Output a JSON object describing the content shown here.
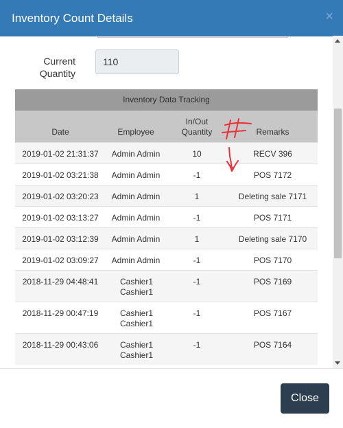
{
  "modal": {
    "title": "Inventory Count Details",
    "close_icon": "close-icon"
  },
  "form": {
    "current_quantity_label": "Current Quantity",
    "current_quantity_value": "110"
  },
  "tracking": {
    "title": "Inventory Data Tracking",
    "columns": [
      "Date",
      "Employee",
      "In/Out Quantity",
      "Remarks"
    ],
    "rows": [
      {
        "date": "2019-01-02 21:31:37",
        "employee": "Admin Admin",
        "quantity": "10",
        "remarks": "RECV 396"
      },
      {
        "date": "2019-01-02 03:21:38",
        "employee": "Admin Admin",
        "quantity": "-1",
        "remarks": "POS 7172"
      },
      {
        "date": "2019-01-02 03:20:23",
        "employee": "Admin Admin",
        "quantity": "1",
        "remarks": "Deleting sale 7171"
      },
      {
        "date": "2019-01-02 03:13:27",
        "employee": "Admin Admin",
        "quantity": "-1",
        "remarks": "POS 7171"
      },
      {
        "date": "2019-01-02 03:12:39",
        "employee": "Admin Admin",
        "quantity": "1",
        "remarks": "Deleting sale 7170"
      },
      {
        "date": "2019-01-02 03:09:27",
        "employee": "Admin Admin",
        "quantity": "-1",
        "remarks": "POS 7170"
      },
      {
        "date": "2018-11-29 04:48:41",
        "employee": "Cashier1 Cashier1",
        "quantity": "-1",
        "remarks": "POS 7169"
      },
      {
        "date": "2018-11-29 00:47:19",
        "employee": "Cashier1 Cashier1",
        "quantity": "-1",
        "remarks": "POS 7167"
      },
      {
        "date": "2018-11-29 00:43:06",
        "employee": "Cashier1 Cashier1",
        "quantity": "-1",
        "remarks": "POS 7164"
      }
    ]
  },
  "footer": {
    "close_label": "Close"
  },
  "colors": {
    "header": "#337ab7",
    "close_button": "#2c3e50",
    "annotation": "#e8323c"
  }
}
